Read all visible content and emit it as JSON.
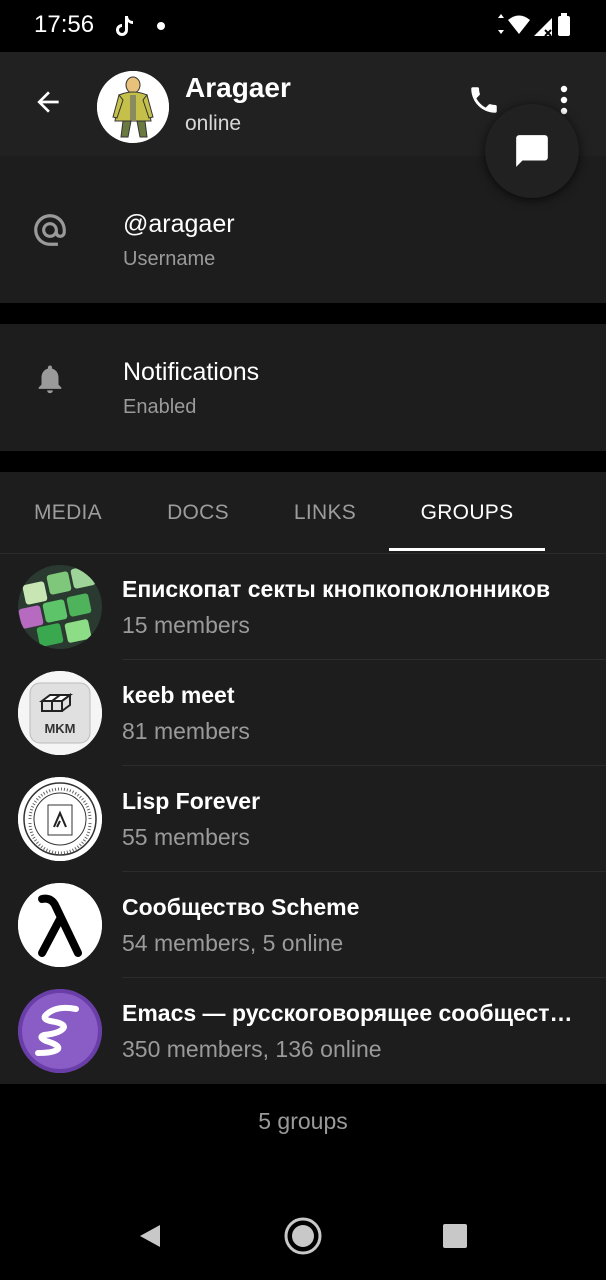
{
  "status_bar": {
    "time": "17:56"
  },
  "header": {
    "contact_name": "Aragaer",
    "contact_status": "online"
  },
  "info": {
    "username": {
      "value": "@aragaer",
      "label": "Username"
    },
    "notifications": {
      "value": "Notifications",
      "label": "Enabled"
    }
  },
  "tabs": [
    {
      "label": "MEDIA"
    },
    {
      "label": "DOCS"
    },
    {
      "label": "LINKS"
    },
    {
      "label": "GROUPS",
      "active": true
    }
  ],
  "groups": [
    {
      "name": "Епископат секты кнопкопоклонников",
      "members": "15 members",
      "avatar": "keycaps-photo"
    },
    {
      "name": "keeb meet",
      "members": "81 members",
      "avatar": "mkm-logo",
      "avatar_text": "MKM"
    },
    {
      "name": "Lisp Forever",
      "members": "55 members",
      "avatar": "mit-seal"
    },
    {
      "name": "Сообщество Scheme",
      "members": "54 members, 5 online",
      "avatar": "lambda-logo"
    },
    {
      "name": "Emacs — русскоговорящее сообщест…",
      "members": "350 members, 136 online",
      "avatar": "emacs-logo"
    }
  ],
  "footer": {
    "groups_count": "5 groups"
  },
  "colors": {
    "background": "#000000",
    "surface": "#1d1d1d",
    "header": "#212121",
    "text_primary": "#ffffff",
    "text_secondary": "#9a9a9a",
    "emacs_purple": "#7e4fb8"
  }
}
